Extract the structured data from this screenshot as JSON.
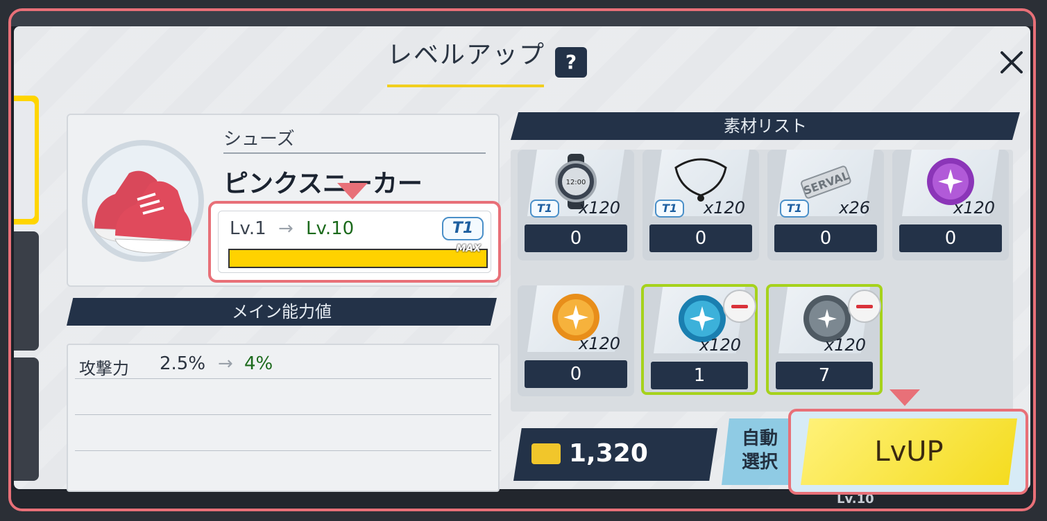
{
  "dialog": {
    "title": "レベルアップ",
    "help_label": "?"
  },
  "item": {
    "category": "シューズ",
    "name": "ピンクスニーカー",
    "level_from": "Lv.1",
    "level_to": "Lv.10",
    "tier": "T1",
    "max_label": "MAX",
    "xp_fill": 1.0,
    "arrow": "→"
  },
  "stats": {
    "header": "メイン能力値",
    "rows": [
      {
        "name": "攻撃力",
        "from": "2.5%",
        "to": "4%"
      }
    ]
  },
  "materials": {
    "header": "素材リスト",
    "items": [
      {
        "icon": "watch-icon",
        "tier": "T1",
        "qty": "x120",
        "count": "0",
        "selected": false
      },
      {
        "icon": "necklace-icon",
        "tier": "T1",
        "qty": "x120",
        "count": "0",
        "selected": false
      },
      {
        "icon": "serval-emblem-icon",
        "tier": "T1",
        "qty": "x26",
        "count": "0",
        "selected": false
      },
      {
        "icon": "purple-orb-icon",
        "tier": "",
        "qty": "x120",
        "count": "0",
        "selected": false
      },
      {
        "icon": "orange-orb-icon",
        "tier": "",
        "qty": "x120",
        "count": "0",
        "selected": false
      },
      {
        "icon": "blue-orb-icon",
        "tier": "",
        "qty": "x120",
        "count": "1",
        "selected": true
      },
      {
        "icon": "gray-orb-icon",
        "tier": "",
        "qty": "x120",
        "count": "7",
        "selected": true
      }
    ]
  },
  "footer": {
    "currency_value": "1,320",
    "auto_select_label_1": "自動",
    "auto_select_label_2": "選択",
    "lvup_label": "LvUP"
  },
  "background": {
    "level_label": "Lv.10"
  },
  "colors": {
    "accent_yellow": "#f4db1d",
    "navy": "#233248",
    "highlight_border": "#e87078",
    "selected_border": "#a6d21c",
    "level_green": "#1c6a1c"
  }
}
